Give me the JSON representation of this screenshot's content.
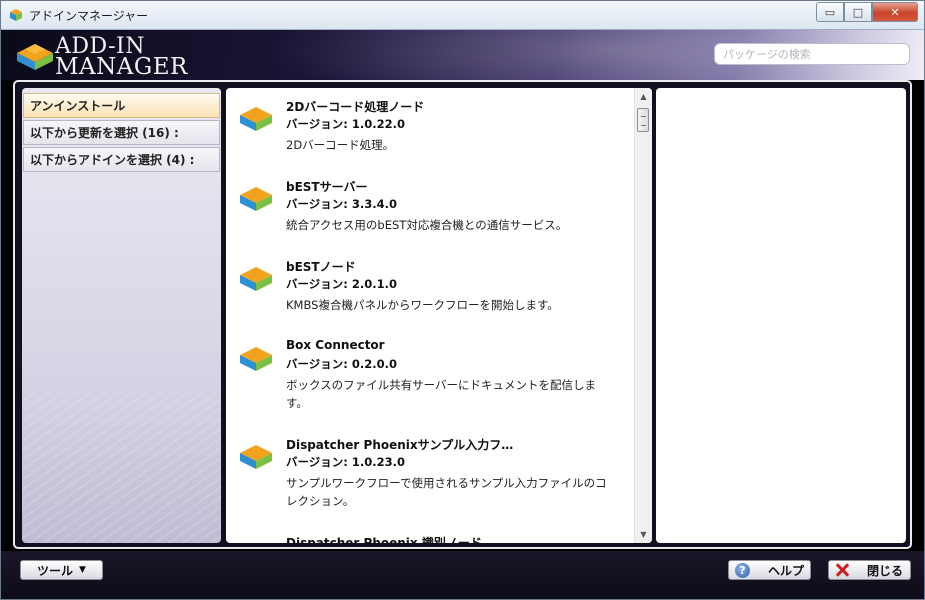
{
  "window": {
    "title": "アドインマネージャー",
    "minimize_glyph": "▭",
    "maximize_glyph": "□",
    "close_glyph": "✕"
  },
  "header": {
    "logo_line1": "ADD-IN",
    "logo_line2": "MANAGER",
    "search_placeholder": "パッケージの検索"
  },
  "sidebar": {
    "items": [
      {
        "label": "アンインストール",
        "active": true
      },
      {
        "label": "以下から更新を選択 (16) :"
      },
      {
        "label": "以下からアドインを選択 (4) :"
      }
    ]
  },
  "list": {
    "items": [
      {
        "name": "2Dバーコード処理ノード",
        "version": "バージョン: 1.0.22.0",
        "description": "2Dバーコード処理。"
      },
      {
        "name": "bESTサーバー",
        "version": "バージョン: 3.3.4.0",
        "description": "統合アクセス用のbEST対応複合機との通信サービス。"
      },
      {
        "name": "bESTノード",
        "version": "バージョン: 2.0.1.0",
        "description": "KMBS複合機パネルからワークフローを開始します。"
      },
      {
        "name": "Box Connector",
        "version": "バージョン: 0.2.0.0",
        "description": "ボックスのファイル共有サーバーにドキュメントを配信します。"
      },
      {
        "name": "Dispatcher Phoenixサンプル入力フ…",
        "version": "バージョン: 1.0.23.0",
        "description": "サンプルワークフローで使用されるサンプル入力ファイルのコレクション。"
      },
      {
        "name": "Dispatcher Phoenix 識別ノード",
        "version": "",
        "description": ""
      }
    ]
  },
  "footer": {
    "tools_label": "ツール",
    "help_label": "ヘルプ",
    "close_label": "閉じる"
  },
  "icons": {
    "app": "addin-cube-icon",
    "help": "help-icon",
    "close": "close-x-icon",
    "caret": "caret-down-icon"
  },
  "colors": {
    "active_tab": "#fbe3b4",
    "close_red": "#d21b1b",
    "header_dark": "#0a0a18"
  }
}
